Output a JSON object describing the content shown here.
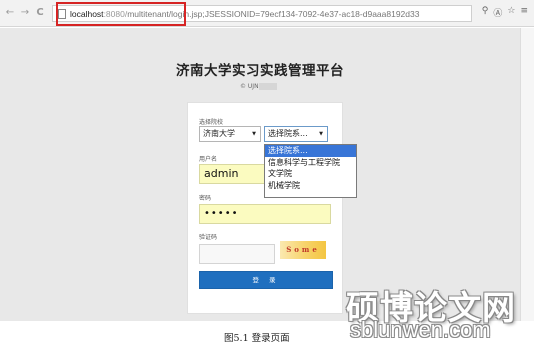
{
  "browser": {
    "back_glyph": "←",
    "forward_glyph": "→",
    "reload_glyph": "C",
    "url_host": "localhost",
    "url_port": ":8080/",
    "url_path": "multitenant/login.jsp;JSESSIONID=79ecf134-7092-4e37-ac18-d9aaa8192d33",
    "tool_icons": [
      "key-icon",
      "translate-icon",
      "star-icon",
      "menu-icon"
    ],
    "tool_glyphs": [
      "⚲",
      "Ⓐ",
      "☆",
      "≡"
    ],
    "highlight_color": "#d62424"
  },
  "page": {
    "title": "济南大学实习实践管理平台",
    "copyright": "© UJN"
  },
  "form": {
    "school_label": "选择院校",
    "school_value": "济南大学",
    "dept_value": "选择院系...",
    "username_label": "用户名",
    "username_value": "admin",
    "password_label": "密码",
    "password_value": "•••••",
    "captcha_label": "验证码",
    "captcha_text": "Some",
    "login_label": "登 录",
    "accent_color": "#1f6fbf"
  },
  "dept_dropdown": {
    "options": [
      "选择院系...",
      "信息科学与工程学院",
      "文学院",
      "机械学院"
    ],
    "selected_index": 0
  },
  "watermark": {
    "cn": "硕博论文网",
    "en": "sblunwen.com"
  },
  "caption": "图5.1 登录页面"
}
